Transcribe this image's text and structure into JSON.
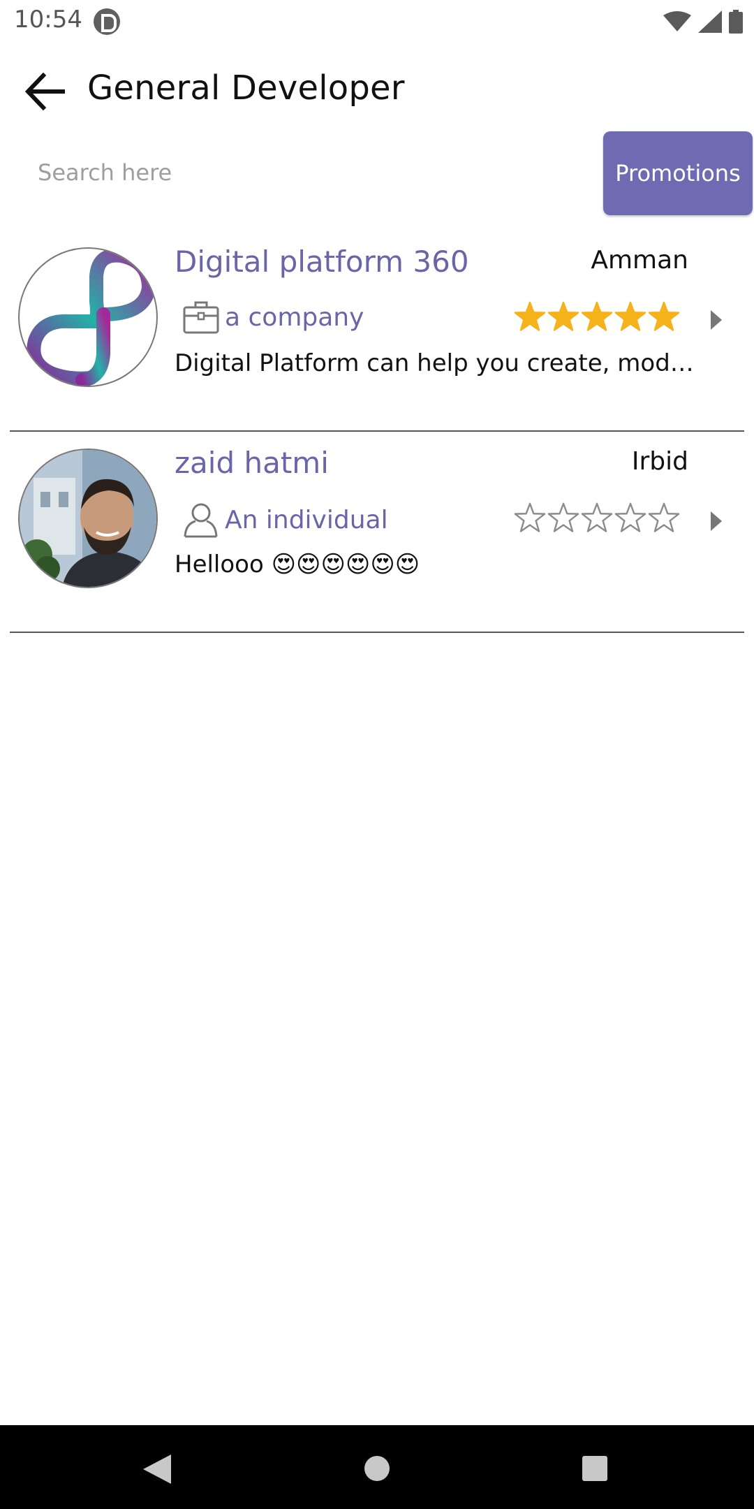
{
  "status_bar": {
    "time": "10:54",
    "icons": [
      "app-notification-icon",
      "wifi-icon",
      "cellular-signal-icon",
      "battery-icon"
    ]
  },
  "app_bar": {
    "title": "General Developer",
    "back_icon": "arrow-left-icon"
  },
  "search": {
    "placeholder": "Search here",
    "value": ""
  },
  "promotions_button": {
    "label": "Promotions",
    "color": "#6f6bb2"
  },
  "items": [
    {
      "name": "Digital platform 360",
      "city": "Amman",
      "type_label": "a company",
      "type_icon": "briefcase-icon",
      "rating": 5,
      "rating_max": 5,
      "description": "Digital Platform can help you create, moderni...",
      "avatar": "digital-platform-logo"
    },
    {
      "name": "zaid hatmi",
      "city": "Irbid",
      "type_label": "An individual",
      "type_icon": "person-icon",
      "rating": 0,
      "rating_max": 5,
      "description": "Hellooo 😍😍😍😍😍😍",
      "avatar": "user-photo"
    }
  ],
  "colors": {
    "accent": "#6a65a8",
    "star_filled": "#f5b21b",
    "star_empty": "#8a8a8a"
  },
  "nav_bar": {
    "icons": [
      "nav-back-icon",
      "nav-home-icon",
      "nav-recents-icon"
    ]
  }
}
